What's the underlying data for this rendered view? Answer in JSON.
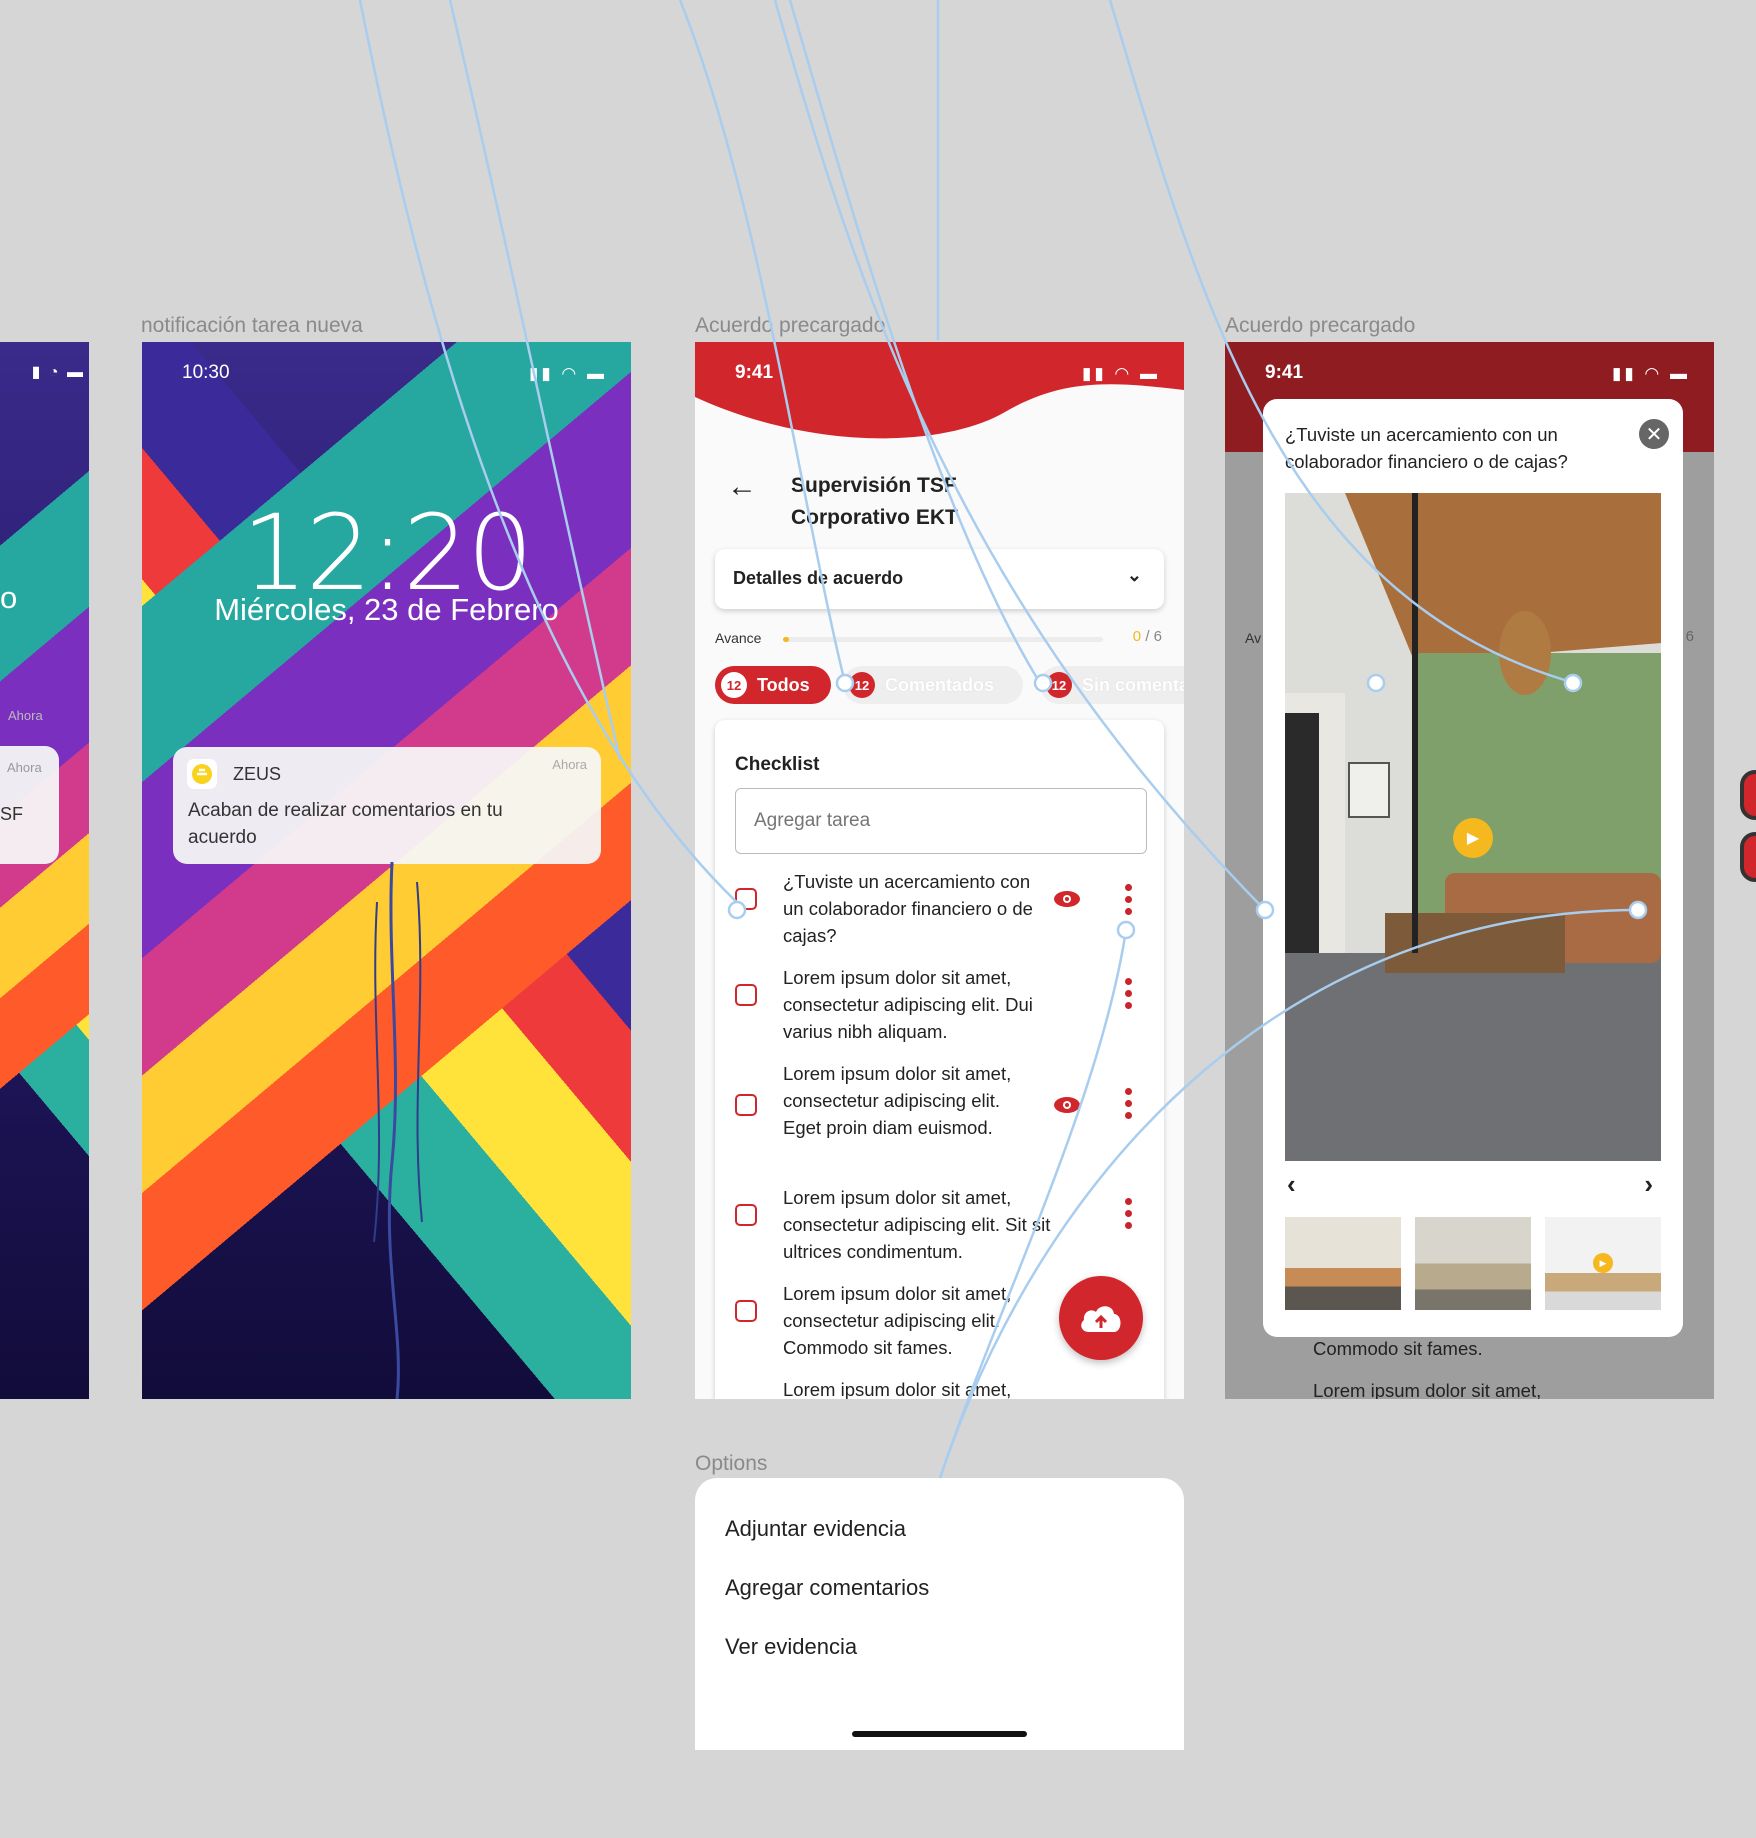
{
  "canvas": {
    "background": "#d6d6d6"
  },
  "labels": {
    "notification_frame": "notificación tarea nueva",
    "agreement_frame_1": "Acuerdo precargado",
    "agreement_frame_2": "Acuerdo precargado",
    "options_frame": "Options"
  },
  "left_partial": {
    "text_o": "o",
    "text_ahora_1": "Ahora",
    "text_ahora_2": "Ahora",
    "text_sf": "SF"
  },
  "lock_screen": {
    "time": "10:30",
    "clock": "12:20",
    "date": "Miércoles, 23 de Febrero",
    "notification": {
      "app_name": "ZEUS",
      "time": "Ahora",
      "message": "Acaban de realizar comentarios en tu acuerdo"
    }
  },
  "agreement": {
    "time": "9:41",
    "title_line1": "Supervisión TSF",
    "title_line2": "Corporativo EKT",
    "details_label": "Detalles de acuerdo",
    "progress_label": "Avance",
    "progress_value": "0",
    "progress_total": "/ 6",
    "progress_fraction": 0,
    "filters": [
      {
        "count": "12",
        "label": "Todos",
        "active": true
      },
      {
        "count": "12",
        "label": "Comentados",
        "active": false
      },
      {
        "count": "12",
        "label": "Sin comentarios",
        "active": false
      }
    ],
    "checklist_title": "Checklist",
    "task_placeholder": "Agregar tarea",
    "items": [
      {
        "text": "¿Tuviste un acercamiento con un colaborador financiero o de cajas?",
        "has_eye": true
      },
      {
        "text": "Lorem ipsum dolor sit amet, consectetur adipiscing elit. Dui varius nibh aliquam.",
        "has_eye": false
      },
      {
        "text": "Lorem ipsum dolor sit amet, consectetur adipiscing elit. Eget proin diam euismod.",
        "has_eye": true
      },
      {
        "text": "Lorem ipsum dolor sit amet, consectetur adipiscing elit. Sit sit ultrices condimentum.",
        "has_eye": false
      },
      {
        "text": "Lorem ipsum dolor sit amet, consectetur adipiscing elit. Commodo sit fames.",
        "has_eye": false
      },
      {
        "text": "Lorem ipsum dolor sit amet,",
        "has_eye": false
      }
    ],
    "colors": {
      "brand_red": "#d0262c",
      "dark_red": "#8e1c20",
      "accent_yellow": "#f5b81f"
    }
  },
  "modal_screen": {
    "time": "9:41",
    "question": "¿Tuviste un acercamiento con un colaborador financiero o de cajas?",
    "behind_text_1": "Commodo sit fames.",
    "behind_text_2": "Lorem ipsum dolor sit amet,",
    "behind_avance": "Av",
    "behind_total": "6"
  },
  "options": {
    "items": [
      "Adjuntar evidencia",
      "Agregar comentarios",
      "Ver evidencia"
    ]
  }
}
